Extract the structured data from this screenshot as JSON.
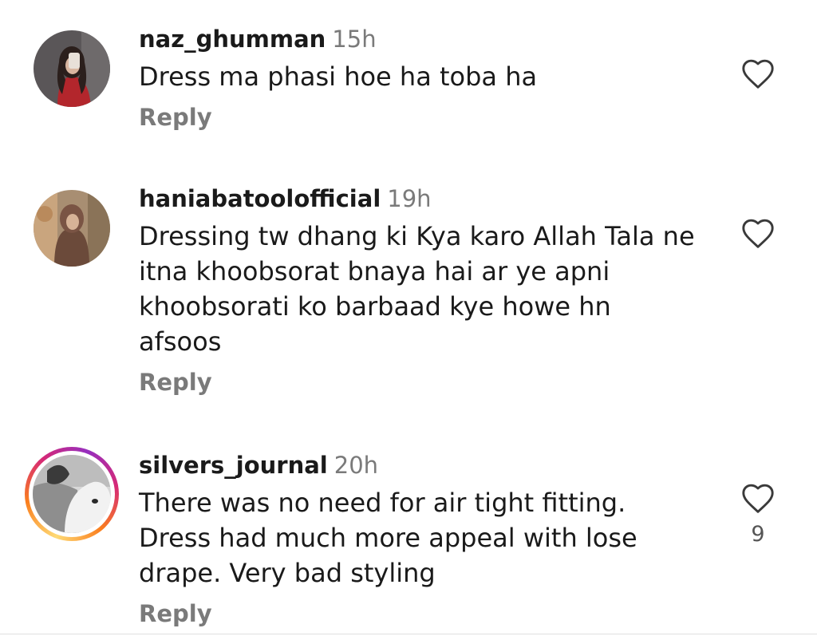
{
  "comments": [
    {
      "username": "naz_ghumman",
      "time": "15h",
      "text": "Dress ma phasi hoe ha toba ha",
      "reply_label": "Reply",
      "like_count": ""
    },
    {
      "username": "haniabatoolofficial",
      "time": "19h",
      "text": "Dressing tw dhang ki Kya karo Allah Tala ne itna khoobsorat bnaya hai ar ye apni khoobsorati ko barbaad kye howe hn afsoos",
      "reply_label": "Reply",
      "like_count": ""
    },
    {
      "username": "silvers_journal",
      "time": "20h",
      "text": "There was no need for air tight fitting. Dress had much more appeal with lose drape. Very bad styling",
      "reply_label": "Reply",
      "like_count": "9"
    }
  ],
  "colors": {
    "username": "#1a1a1a",
    "secondary": "#7a7a7a",
    "story_ring": "#d62976"
  },
  "icons": {
    "like": "heart-outline-icon"
  }
}
